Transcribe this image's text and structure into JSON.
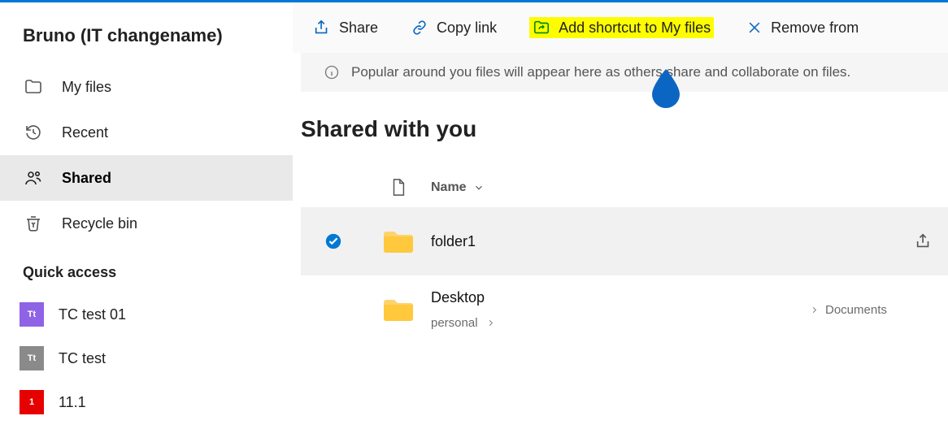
{
  "sidebar": {
    "title": "Bruno (IT changename)",
    "items": [
      {
        "label": "My files"
      },
      {
        "label": "Recent"
      },
      {
        "label": "Shared"
      },
      {
        "label": "Recycle bin"
      }
    ],
    "quickAccessHeading": "Quick access",
    "quick": [
      {
        "label": "TC test 01",
        "chip": "Tt",
        "color": "#8e63e6"
      },
      {
        "label": "TC test",
        "chip": "Tt",
        "color": "#8a8a8a"
      },
      {
        "label": "11.1",
        "chip": "1",
        "color": "#e60000"
      }
    ]
  },
  "toolbar": {
    "share": "Share",
    "copyLink": "Copy link",
    "addShortcut": "Add shortcut to My files",
    "remove": "Remove from"
  },
  "banner": {
    "text": "Popular around you files will appear here as others share and collaborate on files."
  },
  "main": {
    "heading": "Shared with you",
    "columnName": "Name",
    "rows": [
      {
        "name": "folder1",
        "selected": true
      },
      {
        "name": "Desktop",
        "sub": "personal",
        "trail": "Documents"
      }
    ]
  }
}
